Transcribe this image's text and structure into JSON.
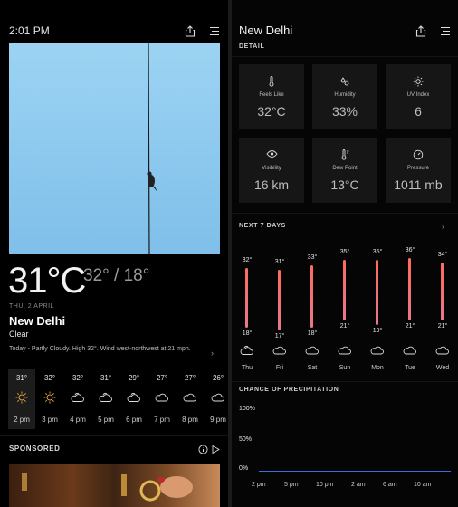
{
  "left": {
    "status_time": "2:01 PM",
    "temperature": "31°C",
    "high": "32°",
    "low": "18°",
    "date": "THU, 2 APRIL",
    "city": "New Delhi",
    "condition": "Clear",
    "summary": "Today - Partly Cloudy. High 32°. Wind west-northwest at 21 mph.",
    "hourly": [
      {
        "temp": "31°",
        "icon": "sun-icon",
        "hour": "2 pm"
      },
      {
        "temp": "32°",
        "icon": "sun-icon",
        "hour": "3 pm"
      },
      {
        "temp": "32°",
        "icon": "partly-cloudy-icon",
        "hour": "4 pm"
      },
      {
        "temp": "31°",
        "icon": "partly-cloudy-icon",
        "hour": "5 pm"
      },
      {
        "temp": "29°",
        "icon": "partly-cloudy-icon",
        "hour": "6 pm"
      },
      {
        "temp": "27°",
        "icon": "cloud-icon",
        "hour": "7 pm"
      },
      {
        "temp": "27°",
        "icon": "cloud-icon",
        "hour": "8 pm"
      },
      {
        "temp": "26°",
        "icon": "cloud-icon",
        "hour": "9 pm"
      }
    ],
    "sponsored_label": "SPONSORED"
  },
  "right": {
    "city": "New Delhi",
    "detail_label": "DETAIL",
    "details": [
      {
        "label": "Feels Like",
        "value": "32°C",
        "icon": "thermometer-icon"
      },
      {
        "label": "Humidity",
        "value": "33%",
        "icon": "droplets-icon"
      },
      {
        "label": "UV Index",
        "value": "6",
        "icon": "sun-icon"
      },
      {
        "label": "Visibility",
        "value": "16 km",
        "icon": "eye-icon"
      },
      {
        "label": "Dew Point",
        "value": "13°C",
        "icon": "dew-thermometer-icon"
      },
      {
        "label": "Pressure",
        "value": "1011 mb",
        "icon": "gauge-icon"
      }
    ],
    "next7_label": "NEXT 7 DAYS",
    "week": [
      {
        "day": "Thu",
        "high": 32,
        "low": 18,
        "high_label": "32°",
        "low_label": "18°",
        "icon": "partly-cloudy-icon"
      },
      {
        "day": "Fri",
        "high": 31,
        "low": 17,
        "high_label": "31°",
        "low_label": "17°",
        "icon": "cloud-icon"
      },
      {
        "day": "Sat",
        "high": 33,
        "low": 18,
        "high_label": "33°",
        "low_label": "18°",
        "icon": "cloud-icon"
      },
      {
        "day": "Sun",
        "high": 35,
        "low": 21,
        "high_label": "35°",
        "low_label": "21°",
        "icon": "cloud-icon"
      },
      {
        "day": "Mon",
        "high": 35,
        "low": 19,
        "high_label": "35°",
        "low_label": "19°",
        "icon": "cloud-icon"
      },
      {
        "day": "Tue",
        "high": 36,
        "low": 21,
        "high_label": "36°",
        "low_label": "21°",
        "icon": "cloud-icon"
      },
      {
        "day": "Wed",
        "high": 34,
        "low": 21,
        "high_label": "34°",
        "low_label": "21°",
        "icon": "cloud-icon"
      }
    ],
    "precip_label": "CHANCE OF PRECIPITATION",
    "precip_y": [
      "100%",
      "50%",
      "0%"
    ],
    "precip_x": [
      "2 pm",
      "5 pm",
      "10 pm",
      "2 am",
      "6 am",
      "10 am"
    ]
  },
  "colors": {
    "bar_top": "#ff6b5a",
    "bar_bottom": "#e6788c",
    "precip_line": "#3d6fd6",
    "sky": "#8cc8ee"
  }
}
